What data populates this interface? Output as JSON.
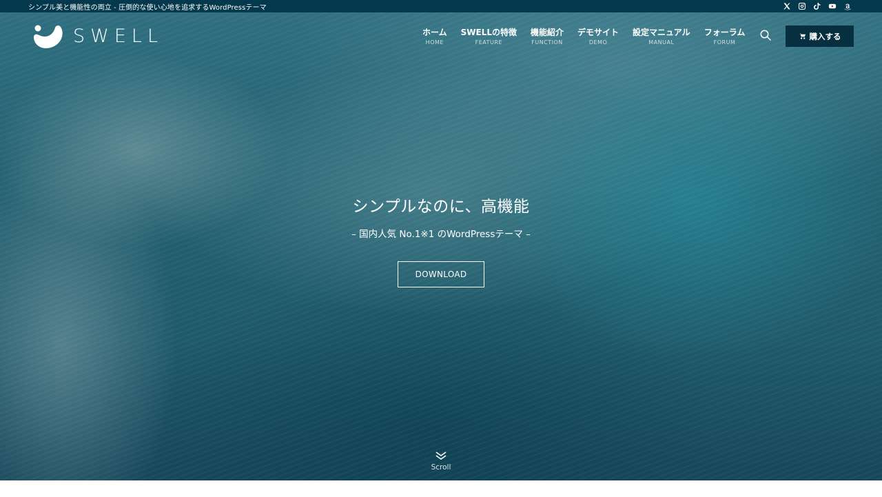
{
  "topbar": {
    "tagline": "シンプル美と機能性の両立 - 圧倒的な使い心地を追求するWordPressテーマ",
    "sns": [
      "x-icon",
      "instagram-icon",
      "tiktok-icon",
      "youtube-icon",
      "amazon-icon"
    ]
  },
  "header": {
    "logo_text": "SWELL",
    "nav": [
      {
        "ja": "ホーム",
        "en": "HOME"
      },
      {
        "ja": "SWELLの特徴",
        "en": "FEATURE"
      },
      {
        "ja": "機能紹介",
        "en": "FUNCTION"
      },
      {
        "ja": "デモサイト",
        "en": "DEMO"
      },
      {
        "ja": "設定マニュアル",
        "en": "MANUAL"
      },
      {
        "ja": "フォーラム",
        "en": "FORUM"
      }
    ],
    "buy_label": "購入する"
  },
  "hero": {
    "main_copy": "シンプルなのに、高機能",
    "sub_copy": "– 国内人気 No.1※1 のWordPressテーマ –",
    "download_label": "DOWNLOAD",
    "scroll_label": "Scroll"
  },
  "colors": {
    "topbar_bg": "#04384c",
    "buy_button_bg": "#06303f",
    "hero_tint": "#23606f"
  }
}
